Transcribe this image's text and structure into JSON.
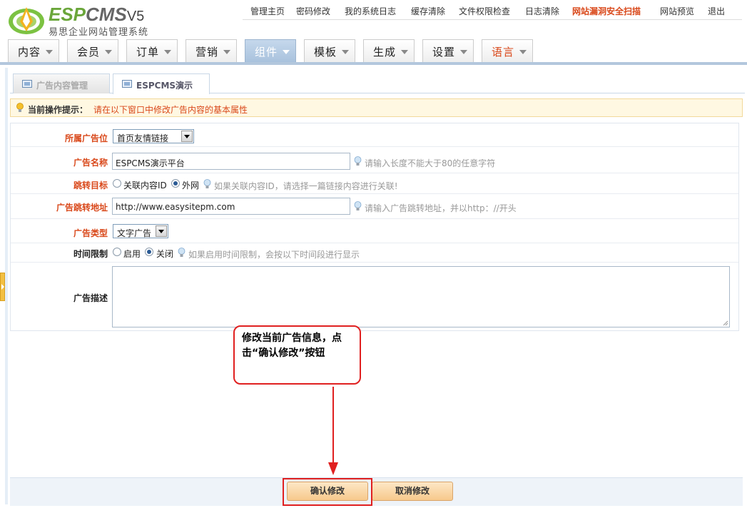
{
  "header": {
    "logo": {
      "brand_esp": "ESP",
      "brand_cms": "CMS",
      "version": "V5",
      "subtitle": "易思企业网站管理系统"
    },
    "top_links": [
      {
        "label": "管理主页",
        "hot": false
      },
      {
        "label": "密码修改",
        "hot": false
      },
      {
        "label": "我的系统日志",
        "hot": false
      },
      {
        "label": "缓存清除",
        "hot": false
      },
      {
        "label": "文件权限检查",
        "hot": false
      },
      {
        "label": "日志清除",
        "hot": false
      },
      {
        "label": "网站漏洞安全扫描",
        "hot": true
      },
      {
        "label": "网站预览",
        "hot": false
      },
      {
        "label": "退出",
        "hot": false
      }
    ]
  },
  "nav": {
    "tabs": [
      {
        "label": "内容",
        "active": false,
        "red": false
      },
      {
        "label": "会员",
        "active": false,
        "red": false
      },
      {
        "label": "订单",
        "active": false,
        "red": false
      },
      {
        "label": "营销",
        "active": false,
        "red": false
      },
      {
        "label": "组件",
        "active": true,
        "red": false
      },
      {
        "label": "模板",
        "active": false,
        "red": false
      },
      {
        "label": "生成",
        "active": false,
        "red": false
      },
      {
        "label": "设置",
        "active": false,
        "red": false
      },
      {
        "label": "语言",
        "active": false,
        "red": true
      }
    ]
  },
  "subtabs": [
    {
      "label": "广告内容管理",
      "active": false
    },
    {
      "label": "ESPCMS演示",
      "active": true
    }
  ],
  "tip": {
    "label": "当前操作提示：",
    "text": "请在以下窗口中修改广告内容的基本属性"
  },
  "form": {
    "ad_position": {
      "label": "所属广告位",
      "value": "首页友情链接"
    },
    "ad_name": {
      "label": "广告名称",
      "value": "ESPCMS演示平台",
      "hint": "请输入长度不能大于80的任意字符"
    },
    "jump_target": {
      "label": "跳转目标",
      "options": [
        "关联内容ID",
        "外网"
      ],
      "selected": "外网",
      "hint": "如果关联内容ID，请选择一篇链接内容进行关联!"
    },
    "ad_url": {
      "label": "广告跳转地址",
      "value": "http://www.easysitepm.com",
      "hint": "请输入广告跳转地址，并以http：//开头"
    },
    "ad_type": {
      "label": "广告类型",
      "value": "文字广告"
    },
    "time_limit": {
      "label": "时间限制",
      "options": [
        "启用",
        "关闭"
      ],
      "selected": "关闭",
      "hint": "如果启用时间限制，会按以下时间段进行显示"
    },
    "ad_desc": {
      "label": "广告描述",
      "value": ""
    }
  },
  "callout": {
    "text": "修改当前广告信息，点击“确认修改”按钮"
  },
  "footer": {
    "confirm_label": "确认修改",
    "cancel_label": "取消修改"
  },
  "colors": {
    "accent_red": "#d9481a",
    "annotation_red": "#e02020",
    "nav_active": "#a9c2dd",
    "brand_green": "#6aa63a",
    "tip_background": "#fff8e2"
  },
  "icons": {
    "hint": "lightbulb-icon",
    "tip": "lightbulb-icon",
    "subtab": "window-icon",
    "dropdown": "chevron-down-icon"
  }
}
